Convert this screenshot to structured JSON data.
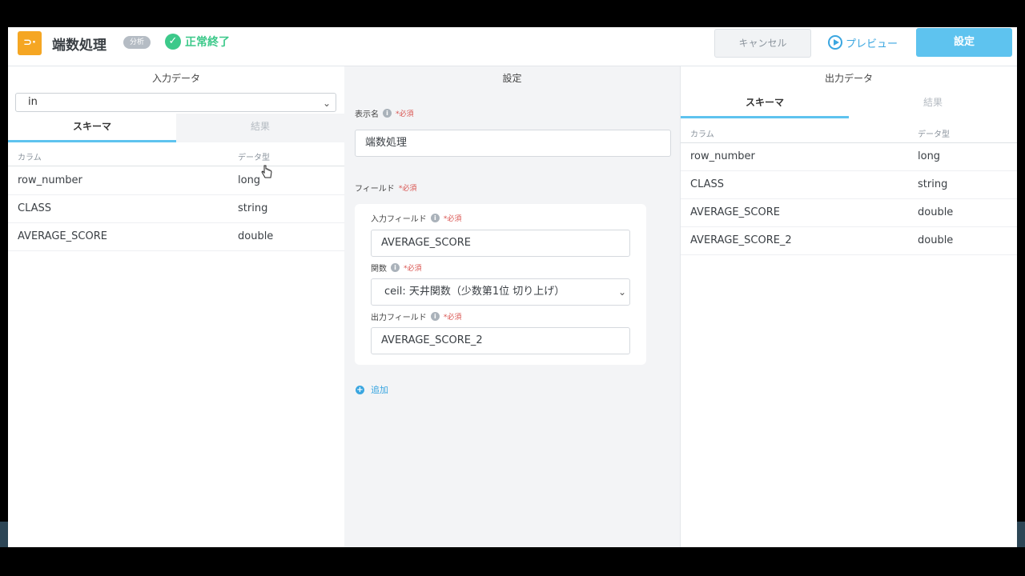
{
  "header": {
    "title": "端数処理",
    "badge": "分析",
    "status": "正常終了",
    "cancel_label": "キャンセル",
    "preview_label": "プレビュー",
    "apply_label": "設定"
  },
  "left": {
    "title": "入力データ",
    "source_select": "in",
    "tabs": [
      "スキーマ",
      "結果"
    ],
    "columns": [
      "カラム",
      "データ型"
    ],
    "rows": [
      {
        "name": "row_number",
        "type": "long"
      },
      {
        "name": "CLASS",
        "type": "string"
      },
      {
        "name": "AVERAGE_SCORE",
        "type": "double"
      }
    ]
  },
  "middle": {
    "title": "設定",
    "display_name_label": "表示名",
    "required": "*必須",
    "display_name_value": "端数処理",
    "fields_label": "フィールド",
    "input_field_label": "入力フィールド",
    "input_field_value": "AVERAGE_SCORE",
    "function_label": "関数",
    "function_value": "ceil: 天井関数（少数第1位 切り上げ）",
    "output_field_label": "出力フィールド",
    "output_field_value": "AVERAGE_SCORE_2",
    "add_label": "追加"
  },
  "right": {
    "title": "出力データ",
    "tabs": [
      "スキーマ",
      "結果"
    ],
    "columns": [
      "カラム",
      "データ型"
    ],
    "rows": [
      {
        "name": "row_number",
        "type": "long"
      },
      {
        "name": "CLASS",
        "type": "string"
      },
      {
        "name": "AVERAGE_SCORE",
        "type": "double"
      },
      {
        "name": "AVERAGE_SCORE_2",
        "type": "double"
      }
    ]
  }
}
